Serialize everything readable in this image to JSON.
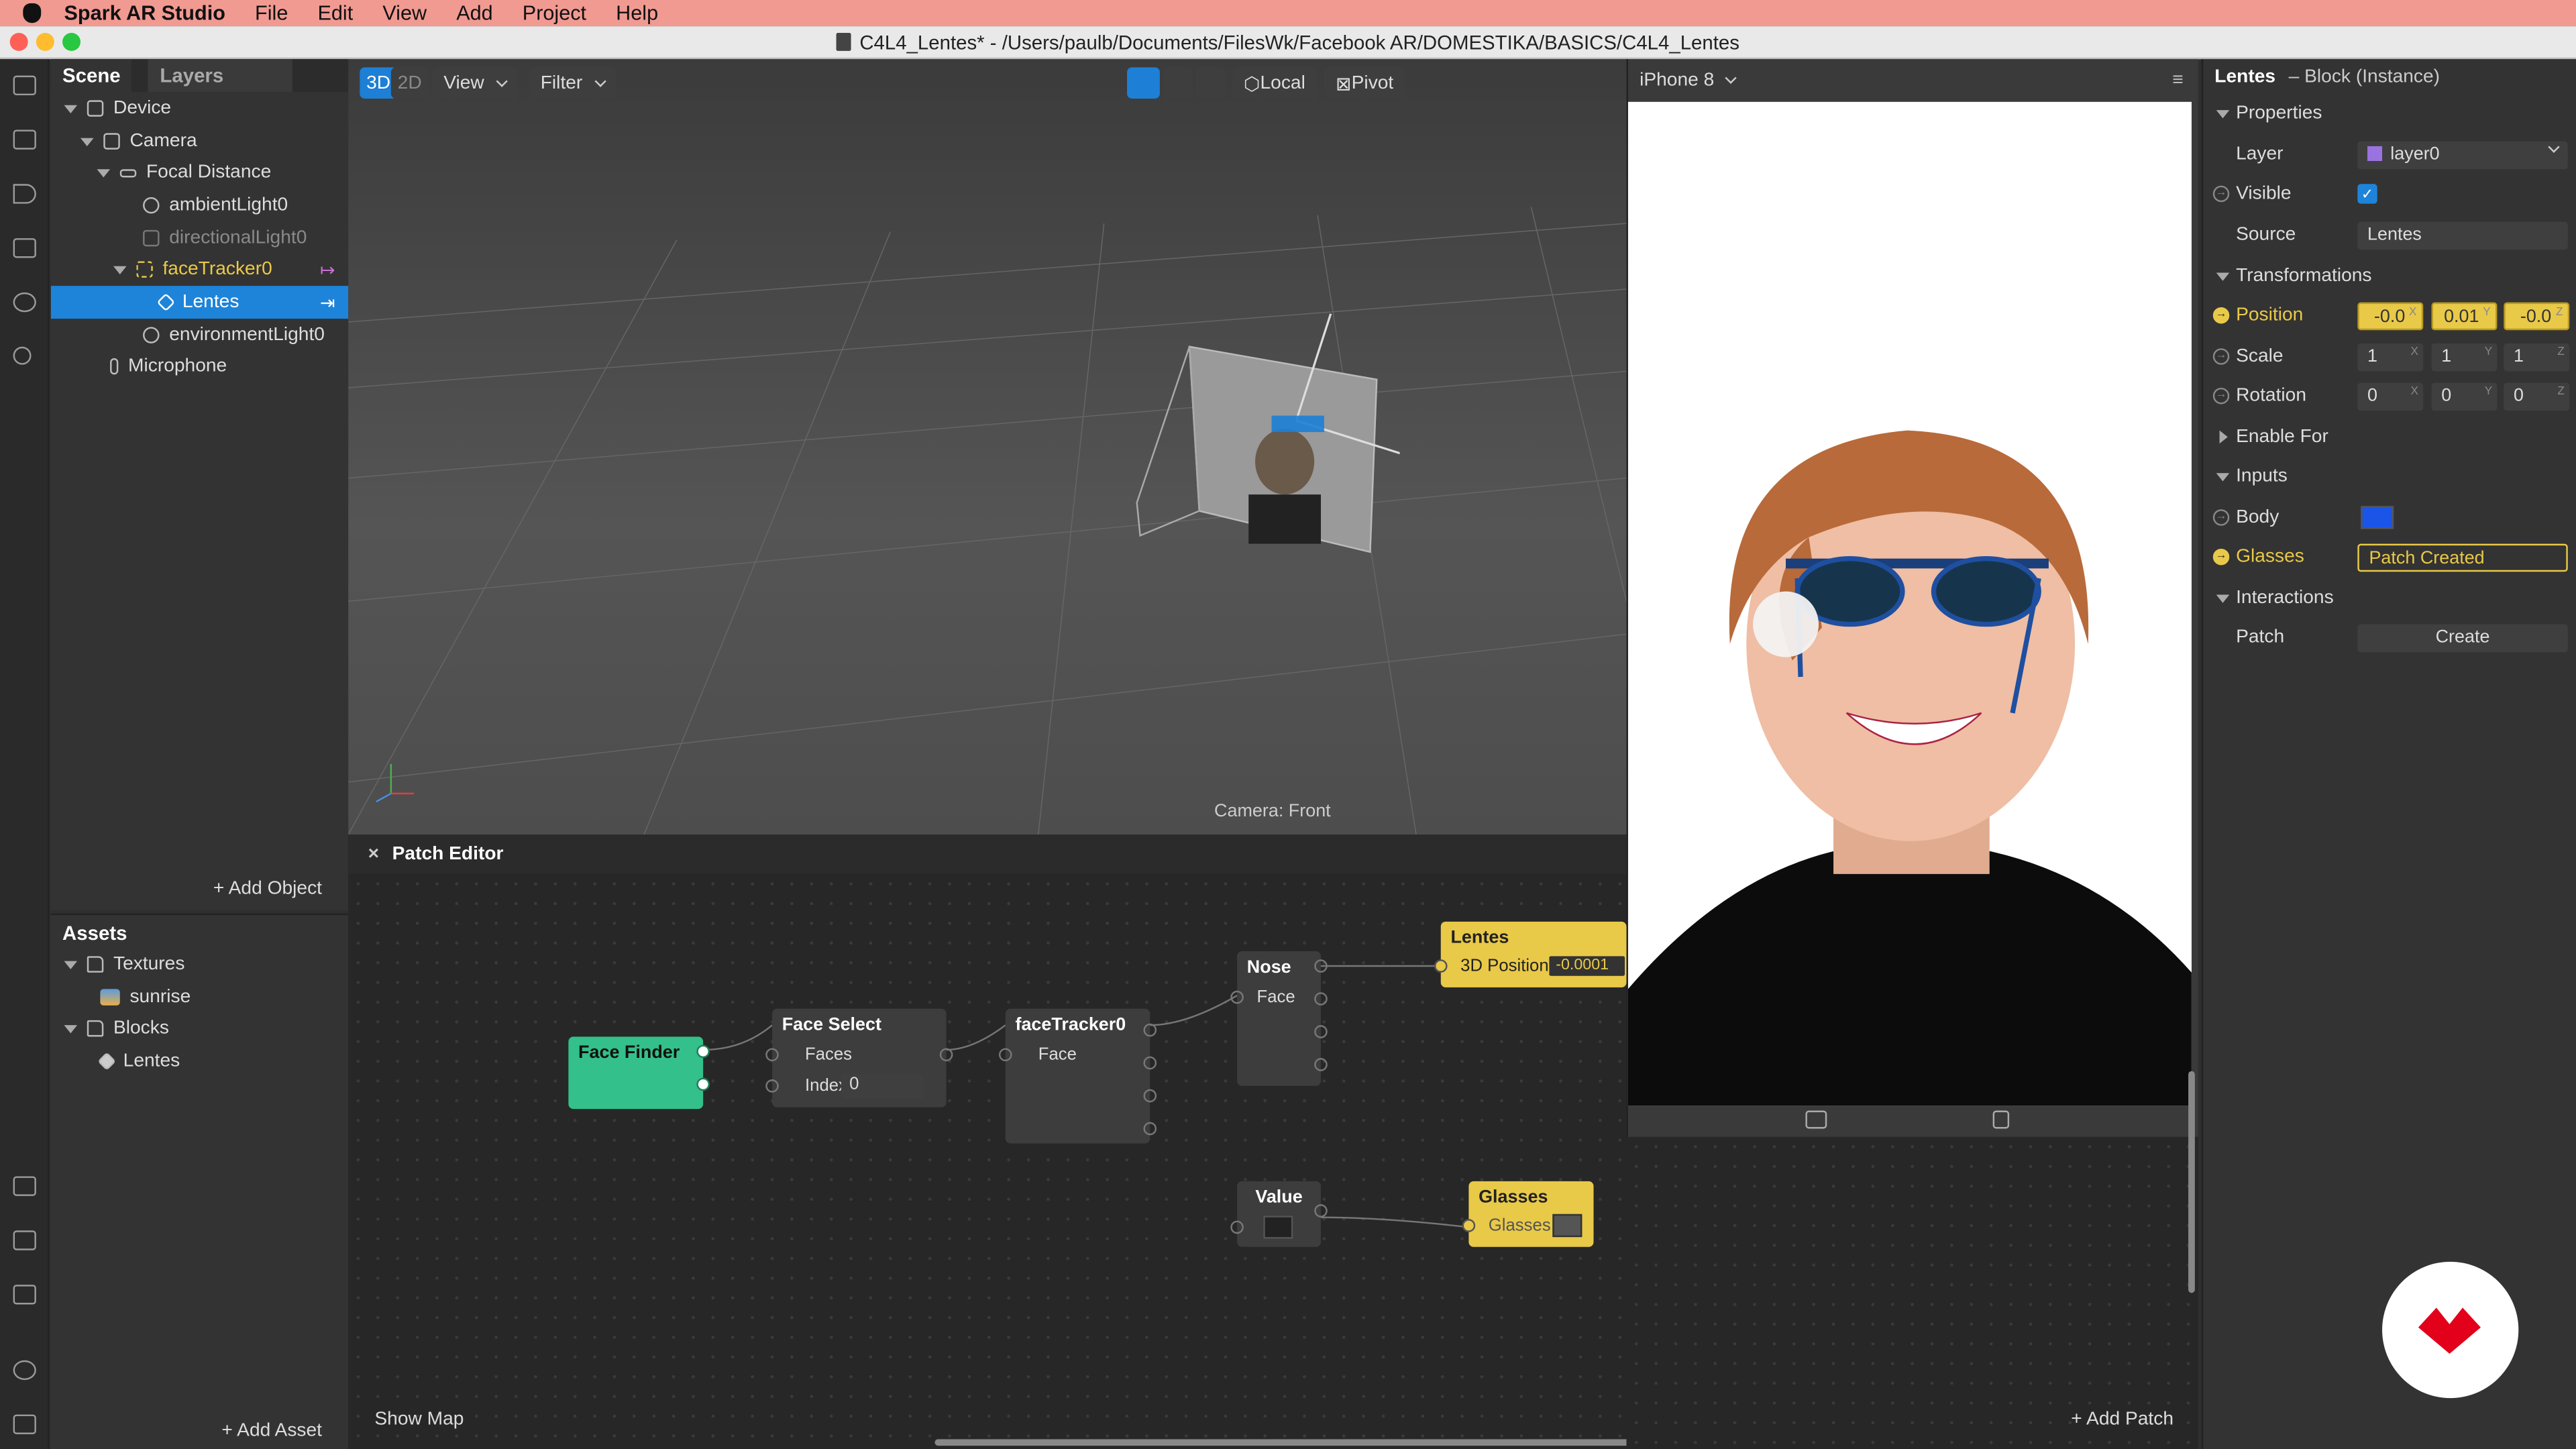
{
  "menubar": {
    "app": "Spark AR Studio",
    "items": [
      "File",
      "Edit",
      "View",
      "Add",
      "Project",
      "Help"
    ]
  },
  "window": {
    "title": "C4L4_Lentes* - /Users/paulb/Documents/FilesWk/Facebook AR/DOMESTIKA/BASICS/C4L4_Lentes"
  },
  "scene": {
    "tabs": [
      "Scene",
      "Layers"
    ],
    "tree": [
      {
        "label": "Device",
        "depth": 0,
        "icon": "device-icon"
      },
      {
        "label": "Camera",
        "depth": 1,
        "icon": "camera-icon"
      },
      {
        "label": "Focal Distance",
        "depth": 2,
        "icon": "focal-distance-icon"
      },
      {
        "label": "ambientLight0",
        "depth": 3,
        "icon": "ambient-light-icon"
      },
      {
        "label": "directionalLight0",
        "depth": 3,
        "icon": "directional-light-icon"
      },
      {
        "label": "faceTracker0",
        "depth": 3,
        "icon": "face-tracker-icon"
      },
      {
        "label": "Lentes",
        "depth": 4,
        "icon": "block-icon"
      },
      {
        "label": "environmentLight0",
        "depth": 3,
        "icon": "environment-light-icon"
      },
      {
        "label": "Microphone",
        "depth": 1,
        "icon": "microphone-icon"
      }
    ],
    "add_object": "Add Object"
  },
  "assets": {
    "title": "Assets",
    "tree": [
      {
        "label": "Textures"
      },
      {
        "label": "sunrise"
      },
      {
        "label": "Blocks"
      },
      {
        "label": "Lentes"
      }
    ],
    "add_asset": "Add Asset"
  },
  "viewport": {
    "mode_3d": "3D",
    "mode_2d": "2D",
    "view": "View",
    "filter": "Filter",
    "local": "Local",
    "pivot": "Pivot",
    "camera_label": "Camera: Front"
  },
  "preview": {
    "device": "iPhone 8"
  },
  "patch_editor": {
    "title": "Patch Editor",
    "show_map": "Show Map",
    "add_patch": "Add Patch",
    "nodes": {
      "face_finder": {
        "title": "Face Finder"
      },
      "face_select": {
        "title": "Face Select",
        "faces": "Faces",
        "index_label": "Index",
        "index_value": "0"
      },
      "face_tracker": {
        "title": "faceTracker0",
        "face": "Face"
      },
      "nose": {
        "title": "Nose",
        "face": "Face"
      },
      "lentes": {
        "title": "Lentes",
        "input": "3D Position",
        "value": "-0.0001"
      },
      "value": {
        "title": "Value"
      },
      "glasses": {
        "title": "Glasses",
        "input": "Glasses"
      }
    }
  },
  "inspector": {
    "object": "Lentes",
    "type": "– Block (Instance)",
    "properties": "Properties",
    "layer_label": "Layer",
    "layer_value": "layer0",
    "visible_label": "Visible",
    "source_label": "Source",
    "source_value": "Lentes",
    "transformations": "Transformations",
    "position_label": "Position",
    "position": [
      "-0.0",
      "0.01",
      "-0.0"
    ],
    "scale_label": "Scale",
    "scale": [
      "1",
      "1",
      "1"
    ],
    "rotation_label": "Rotation",
    "rotation": [
      "0",
      "0",
      "0"
    ],
    "axes": [
      "X",
      "Y",
      "Z"
    ],
    "enable_for": "Enable For",
    "inputs": "Inputs",
    "body_label": "Body",
    "body_color": "#1a55e8",
    "glasses_label": "Glasses",
    "glasses_value": "Patch Created",
    "interactions": "Interactions",
    "patch_label": "Patch",
    "create_button": "Create"
  },
  "colors": {
    "accent": "#1d84d9",
    "yellow": "#e9c948",
    "green": "#33c08a",
    "menubar": "#f19a92"
  }
}
